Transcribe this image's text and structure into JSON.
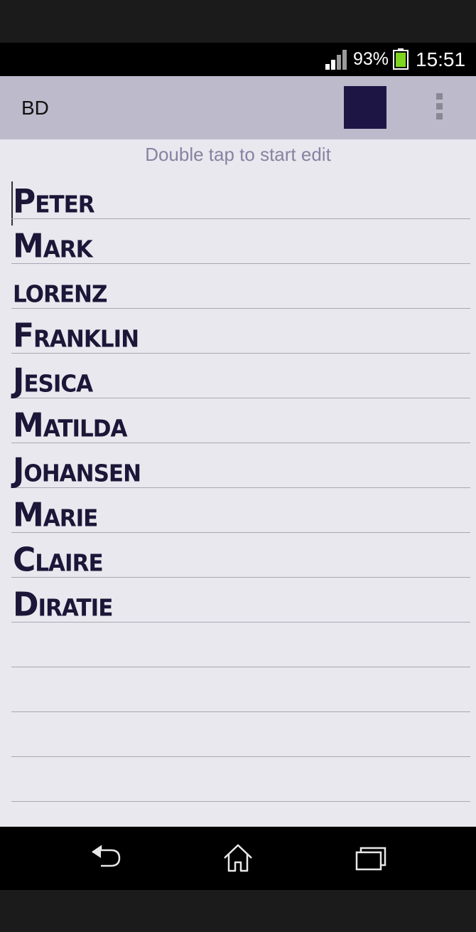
{
  "status_bar": {
    "battery_percent": "93%",
    "time": "15:51",
    "signal_icon": "signal-bars-icon",
    "battery_icon": "battery-icon",
    "battery_color": "#7fd41f"
  },
  "app_bar": {
    "title": "BD",
    "swatch_color": "#1d1645",
    "menu_icon": "overflow-menu-icon"
  },
  "content": {
    "hint": "Double tap to start edit",
    "lines": [
      "Peter",
      "Mark",
      "lorenz",
      "Franklin",
      "Jesica",
      "Matilda",
      "Johansen",
      "Marie",
      "Claire",
      "Diratie",
      "",
      "",
      "",
      ""
    ]
  },
  "nav_bar": {
    "back_icon": "back-icon",
    "home_icon": "home-icon",
    "recents_icon": "recent-apps-icon"
  }
}
